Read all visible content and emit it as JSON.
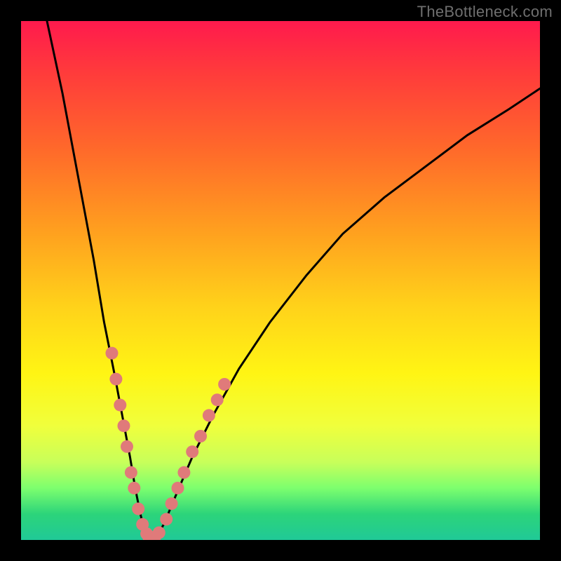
{
  "watermark": "TheBottleneck.com",
  "chart_data": {
    "type": "line",
    "title": "",
    "xlabel": "",
    "ylabel": "",
    "xlim": [
      0,
      100
    ],
    "ylim": [
      0,
      100
    ],
    "background_gradient": {
      "top_color": "#ff1a4d",
      "mid_color": "#ffd21a",
      "bottom_color": "#20c997"
    },
    "series": [
      {
        "name": "bottleneck-curve",
        "x": [
          5,
          8,
          11,
          14,
          16,
          18,
          19.5,
          21,
          22,
          23,
          24,
          25,
          26,
          27.5,
          30,
          33,
          37,
          42,
          48,
          55,
          62,
          70,
          78,
          86,
          94,
          100
        ],
        "y": [
          100,
          86,
          70,
          54,
          42,
          32,
          24,
          16,
          10,
          5,
          1,
          0,
          0.5,
          3,
          9,
          16,
          24,
          33,
          42,
          51,
          59,
          66,
          72,
          78,
          83,
          87
        ]
      }
    ],
    "markers": {
      "name": "dot-cluster",
      "color": "#e07a7a",
      "radius_px": 9,
      "points": [
        {
          "x": 17.5,
          "y": 36
        },
        {
          "x": 18.3,
          "y": 31
        },
        {
          "x": 19.1,
          "y": 26
        },
        {
          "x": 19.8,
          "y": 22
        },
        {
          "x": 20.4,
          "y": 18
        },
        {
          "x": 21.2,
          "y": 13
        },
        {
          "x": 21.8,
          "y": 10
        },
        {
          "x": 22.6,
          "y": 6
        },
        {
          "x": 23.4,
          "y": 3
        },
        {
          "x": 24.2,
          "y": 1.2
        },
        {
          "x": 24.6,
          "y": 0.6
        },
        {
          "x": 25.2,
          "y": 0.4
        },
        {
          "x": 25.8,
          "y": 0.6
        },
        {
          "x": 26.6,
          "y": 1.4
        },
        {
          "x": 28.0,
          "y": 4
        },
        {
          "x": 29.0,
          "y": 7
        },
        {
          "x": 30.2,
          "y": 10
        },
        {
          "x": 31.4,
          "y": 13
        },
        {
          "x": 33.0,
          "y": 17
        },
        {
          "x": 34.6,
          "y": 20
        },
        {
          "x": 36.2,
          "y": 24
        },
        {
          "x": 37.8,
          "y": 27
        },
        {
          "x": 39.2,
          "y": 30
        }
      ]
    }
  }
}
